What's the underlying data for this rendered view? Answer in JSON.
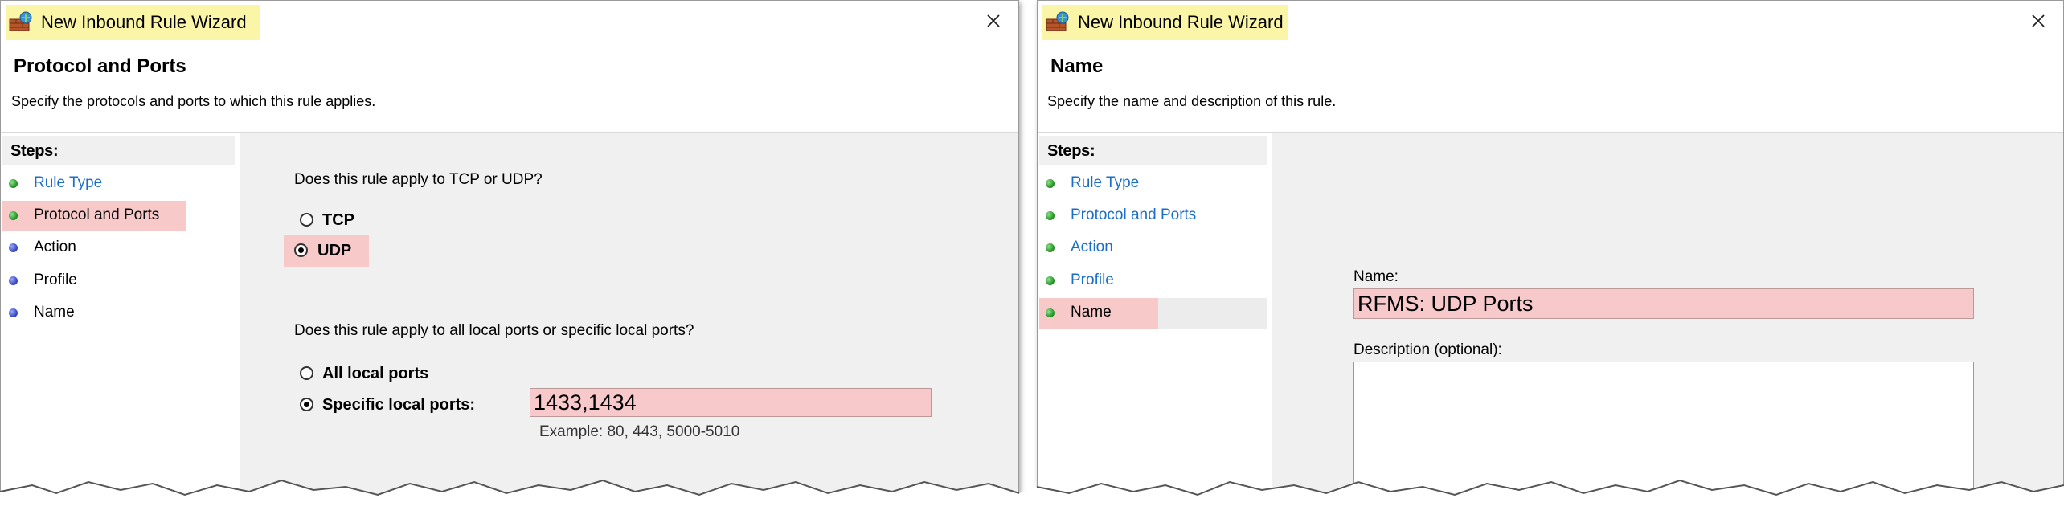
{
  "left_dialog": {
    "title": "New Inbound Rule Wizard",
    "header_title": "Protocol and Ports",
    "header_desc": "Specify the protocols and ports to which this rule applies.",
    "steps_title": "Steps:",
    "steps": [
      "Rule Type",
      "Protocol and Ports",
      "Action",
      "Profile",
      "Name"
    ],
    "question_protocol": "Does this rule apply to TCP or UDP?",
    "protocol_options": [
      "TCP",
      "UDP"
    ],
    "protocol_selected": "UDP",
    "question_ports": "Does this rule apply to all local ports or specific local ports?",
    "port_options": [
      "All local ports",
      "Specific local ports:"
    ],
    "port_selected": "Specific local ports:",
    "ports_value": "1433,1434",
    "ports_example": "Example: 80, 443, 5000-5010"
  },
  "right_dialog": {
    "title": "New Inbound Rule Wizard",
    "header_title": "Name",
    "header_desc": "Specify the name and description of this rule.",
    "steps_title": "Steps:",
    "steps": [
      "Rule Type",
      "Protocol and Ports",
      "Action",
      "Profile",
      "Name"
    ],
    "name_label": "Name:",
    "name_value": "RFMS: UDP Ports",
    "description_label": "Description (optional):",
    "description_value": ""
  },
  "colors": {
    "highlight_title": "#fbf5a8",
    "highlight_pink": "#f7c9c9",
    "link_blue": "#1a6ec9",
    "panel_grey": "#f0f0f0"
  },
  "icons": [
    "firewall-app-icon",
    "close-icon",
    "step-dot-green-icon",
    "step-dot-blue-icon",
    "radio-button-icon"
  ]
}
